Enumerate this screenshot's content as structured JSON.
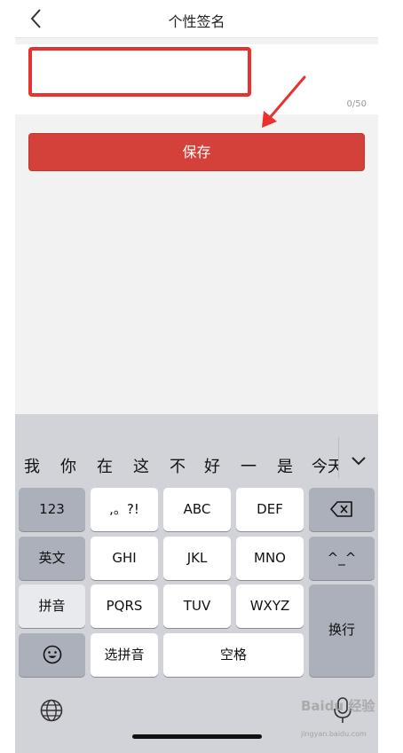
{
  "nav": {
    "title": "个性签名"
  },
  "signature": {
    "value": "",
    "counter": "0/50"
  },
  "save_label": "保存",
  "candidates": [
    "我",
    "你",
    "在",
    "这",
    "不",
    "好",
    "一",
    "是",
    "今天"
  ],
  "keys": {
    "num": "123",
    "punct": ",。?!",
    "abc": "ABC",
    "def": "DEF",
    "english": "英文",
    "ghi": "GHI",
    "jkl": "JKL",
    "mno": "MNO",
    "emoticon": "^_^",
    "pinyin": "拼音",
    "pqrs": "PQRS",
    "tuv": "TUV",
    "wxyz": "WXYZ",
    "newline": "换行",
    "select_pinyin": "选拼音",
    "space": "空格"
  },
  "watermark": {
    "brand": "Baidu 经验",
    "url": "jingyan.baidu.com"
  },
  "colors": {
    "accent": "#d3413a",
    "highlight": "#e8322d"
  }
}
